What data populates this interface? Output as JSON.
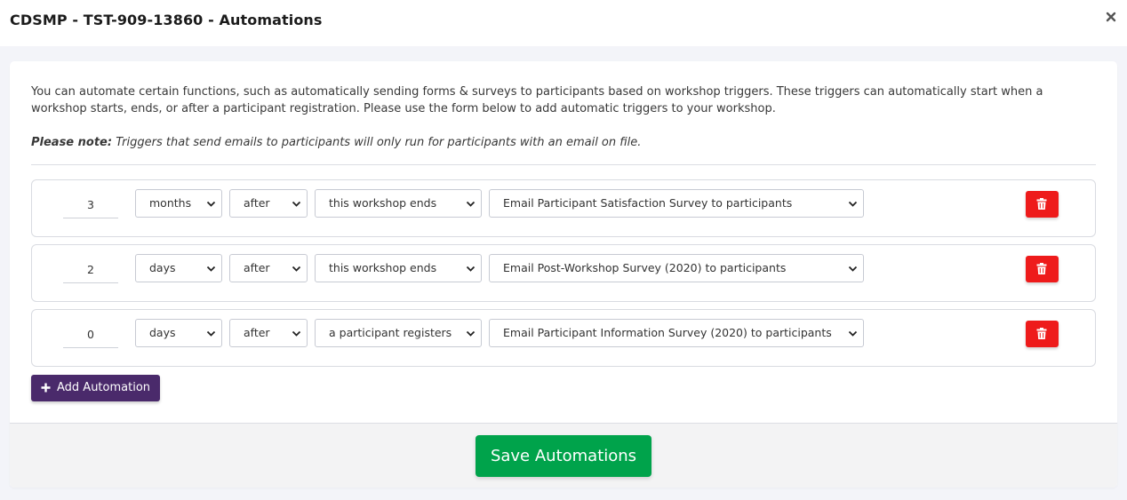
{
  "modal": {
    "title": "CDSMP - TST-909-13860 - Automations",
    "close_icon": "close-icon"
  },
  "intro": {
    "text": "You can automate certain functions, such as automatically sending forms & surveys to participants based on workshop triggers. These triggers can automatically start when a workshop starts, ends, or after a participant registration. Please use the form below to add automatic triggers to your workshop.",
    "note_label": "Please note:",
    "note_text": "Triggers that send emails to participants will only run for participants with an email on file."
  },
  "rules": [
    {
      "amount": "3",
      "unit": "months",
      "when": "after",
      "trigger": "this workshop ends",
      "action": "Email Participant Satisfaction Survey to participants"
    },
    {
      "amount": "2",
      "unit": "days",
      "when": "after",
      "trigger": "this workshop ends",
      "action": "Email Post-Workshop Survey (2020) to participants"
    },
    {
      "amount": "0",
      "unit": "days",
      "when": "after",
      "trigger": "a participant registers",
      "action": "Email Participant Information Survey (2020) to participants"
    }
  ],
  "buttons": {
    "add_label": "Add Automation",
    "save_label": "Save Automations"
  },
  "colors": {
    "delete": "#ee1b1b",
    "add": "#4a2a6b",
    "save": "#00a34b"
  }
}
